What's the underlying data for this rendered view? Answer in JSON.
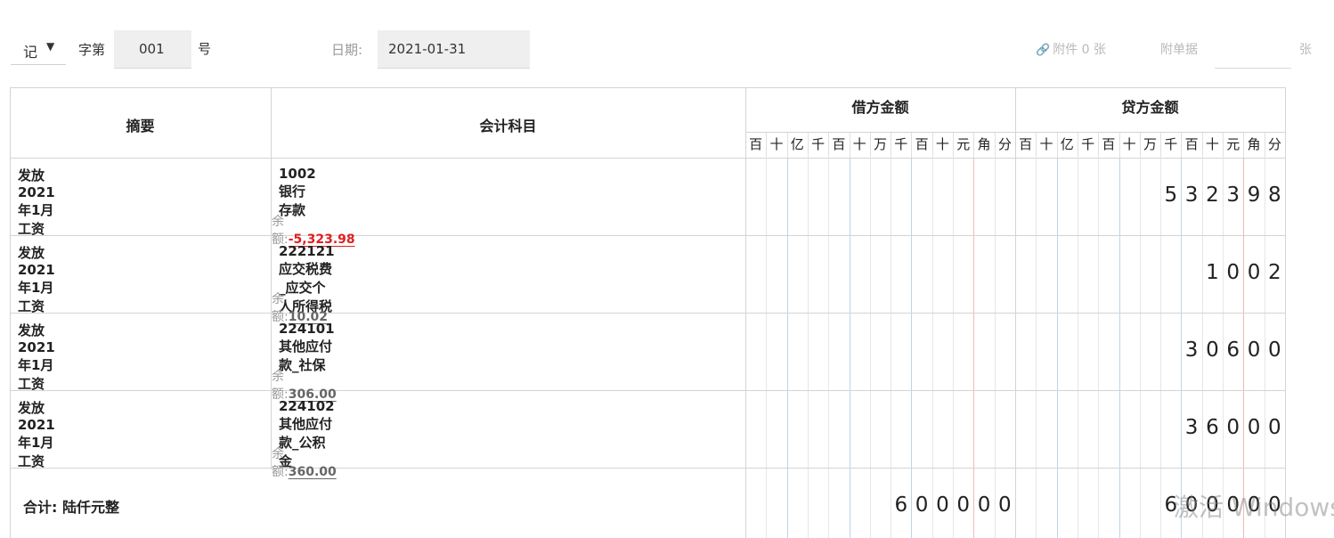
{
  "header": {
    "voucher_type": "记",
    "word_label": "字第",
    "voucher_number": "001",
    "number_suffix": "号",
    "date_label": "日期:",
    "date_value": "2021-01-31",
    "attachment_link": "附件 0 张",
    "attached_docs_label": "附单据",
    "attached_docs_value": "",
    "attached_docs_unit": "张"
  },
  "table": {
    "col_summary": "摘要",
    "col_account": "会计科目",
    "col_debit": "借方金额",
    "col_credit": "贷方金额",
    "digit_units": [
      "百",
      "十",
      "亿",
      "千",
      "百",
      "十",
      "万",
      "千",
      "百",
      "十",
      "元",
      "角",
      "分"
    ],
    "balance_label": "余额:",
    "rows": [
      {
        "summary": "发放2021年1月工资",
        "account": "1002 银行存款",
        "balance": "-5,323.98",
        "debit": "",
        "credit": "532398"
      },
      {
        "summary": "发放2021年1月工资",
        "account": "222121 应交税费_应交个人所得税",
        "balance": "10.02",
        "debit": "",
        "credit": "1002"
      },
      {
        "summary": "发放2021年1月工资",
        "account": "224101 其他应付款_社保",
        "balance": "306.00",
        "debit": "",
        "credit": "30600"
      },
      {
        "summary": "发放2021年1月工资",
        "account": "224102 其他应付款_公积金",
        "balance": "360.00",
        "debit": "",
        "credit": "36000"
      }
    ],
    "total_label": "合计:  陆仟元整",
    "total_debit": "600000",
    "total_credit": "600000"
  },
  "watermark": "激活 Windows",
  "colors": {
    "negative_balance": "#e02020",
    "yuan_divider": "#f0b8b8",
    "group_divider": "#b9d6ea",
    "grid": "#e6e6e6"
  }
}
